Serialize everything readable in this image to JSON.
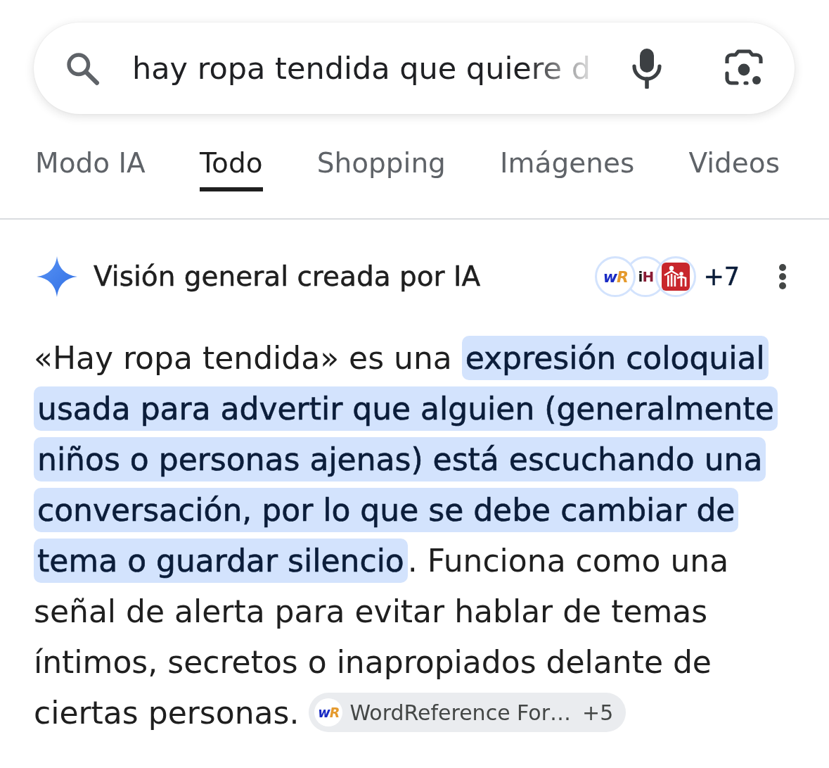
{
  "search_bar": {
    "query": "hay ropa tendida que quiere d"
  },
  "tabs": [
    {
      "label": "Modo IA",
      "selected": false
    },
    {
      "label": "Todo",
      "selected": true
    },
    {
      "label": "Shopping",
      "selected": false
    },
    {
      "label": "Imágenes",
      "selected": false
    },
    {
      "label": "Videos",
      "selected": false
    }
  ],
  "ai_overview": {
    "title": "Visión general creada por IA",
    "sources": [
      {
        "kind": "wordreference",
        "logo_text": "wR"
      },
      {
        "kind": "monogram",
        "logo_text": "iH"
      },
      {
        "kind": "figures"
      }
    ],
    "more_sources": "+7",
    "summary": [
      {
        "text": "«Hay ropa tendida» es una ",
        "highlighted": false
      },
      {
        "text": "expresión coloquial usada para advertir que alguien (generalmente niños o personas ajenas) está escuchando una conversación, por lo que se debe cambiar de tema o guardar silencio",
        "highlighted": true
      },
      {
        "text": ". Funciona como una señal de alerta para evitar hablar de temas íntimos, secretos o inapropiados delante de ciertas personas.",
        "highlighted": false
      }
    ],
    "citation": {
      "kind": "wordreference",
      "logo_text": "wR",
      "label": "WordReference For…",
      "count": "+5"
    }
  }
}
